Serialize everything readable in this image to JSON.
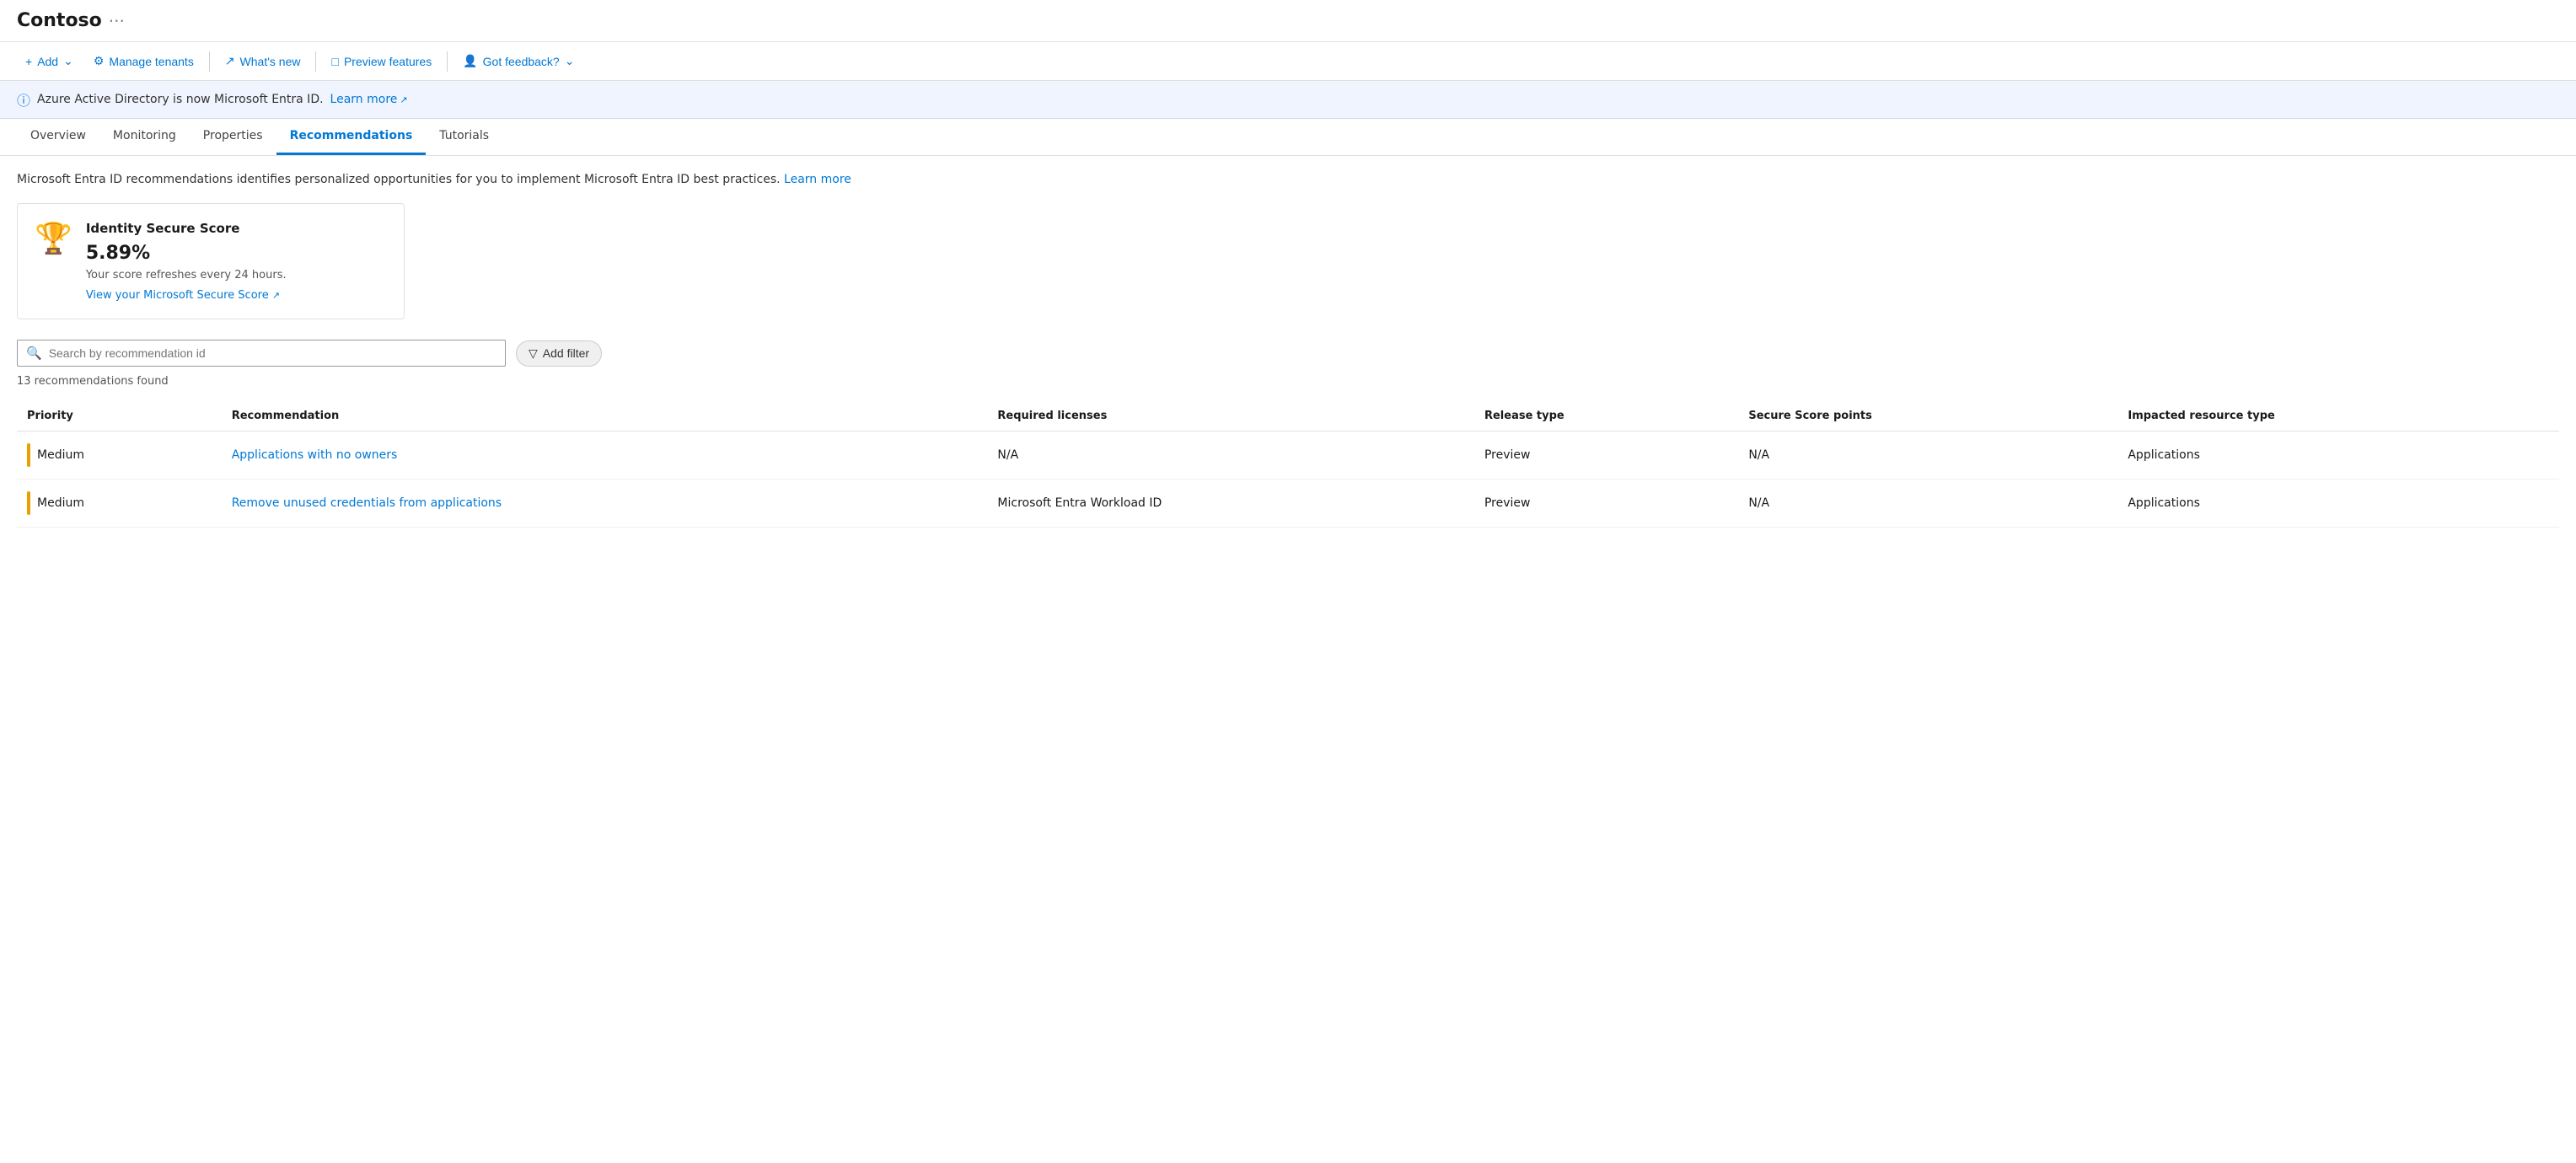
{
  "header": {
    "title": "Contoso",
    "dots": "···"
  },
  "toolbar": {
    "add_label": "Add",
    "manage_tenants_label": "Manage tenants",
    "whats_new_label": "What's new",
    "preview_features_label": "Preview features",
    "got_feedback_label": "Got feedback?"
  },
  "info_banner": {
    "text": "Azure Active Directory is now Microsoft Entra ID.",
    "learn_more": "Learn more"
  },
  "tabs": [
    {
      "label": "Overview",
      "active": false
    },
    {
      "label": "Monitoring",
      "active": false
    },
    {
      "label": "Properties",
      "active": false
    },
    {
      "label": "Recommendations",
      "active": true
    },
    {
      "label": "Tutorials",
      "active": false
    }
  ],
  "page": {
    "description": "Microsoft Entra ID recommendations identifies personalized opportunities for you to implement Microsoft Entra ID best practices.",
    "learn_more_link": "Learn more"
  },
  "score_card": {
    "title": "Identity Secure Score",
    "value": "5.89%",
    "note": "Your score refreshes every 24 hours.",
    "link_text": "View your Microsoft Secure Score"
  },
  "search": {
    "placeholder": "Search by recommendation id",
    "filter_label": "Add filter"
  },
  "results": {
    "count_text": "13 recommendations found"
  },
  "table": {
    "columns": [
      "Priority",
      "Recommendation",
      "Required licenses",
      "Release type",
      "Secure Score points",
      "Impacted resource type"
    ],
    "rows": [
      {
        "priority": "Medium",
        "priority_level": "medium",
        "recommendation": "Applications with no owners",
        "required_licenses": "N/A",
        "release_type": "Preview",
        "secure_score_points": "N/A",
        "impacted_resource_type": "Applications"
      },
      {
        "priority": "Medium",
        "priority_level": "medium",
        "recommendation": "Remove unused credentials from applications",
        "required_licenses": "Microsoft Entra Workload ID",
        "release_type": "Preview",
        "secure_score_points": "N/A",
        "impacted_resource_type": "Applications"
      }
    ]
  }
}
